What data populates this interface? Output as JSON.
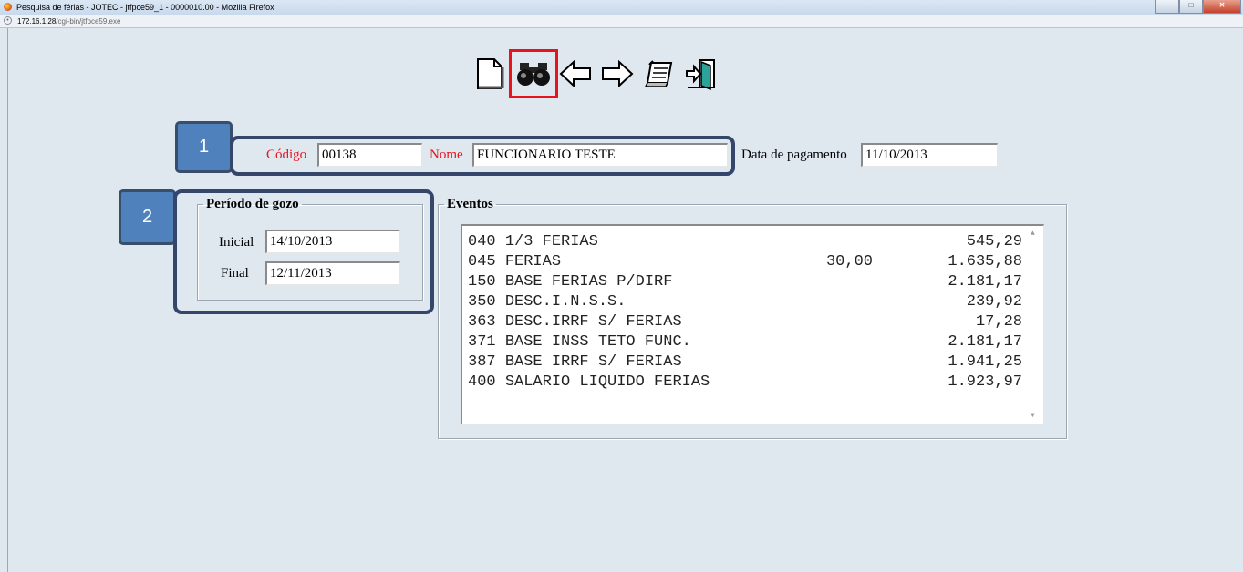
{
  "window": {
    "title": "Pesquisa de férias - JOTEC - jtfpce59_1 - 0000010.00 - Mozilla Firefox"
  },
  "address": {
    "host": "172.16.1.28",
    "path": "/cgi-bin/jtfpce59.exe"
  },
  "toolbar": {
    "icons": [
      "new-document-icon",
      "binoculars-search-icon",
      "arrow-left-icon",
      "arrow-right-icon",
      "notepad-icon",
      "exit-door-icon"
    ],
    "selected": "binoculars-search-icon",
    "highlight_color": "#e8141c"
  },
  "annotations": {
    "box1": "1",
    "box2": "2",
    "color": "#4f81bd"
  },
  "header": {
    "codigo_label": "Código",
    "codigo_value": "00138",
    "nome_label": "Nome",
    "nome_value": "FUNCIONARIO TESTE",
    "data_label": "Data de pagamento",
    "data_value": "11/10/2013"
  },
  "periodo": {
    "legend": "Período de gozo",
    "inicial_label": "Inicial",
    "inicial_value": "14/10/2013",
    "final_label": "Final",
    "final_value": "12/11/2013"
  },
  "eventos": {
    "legend": "Eventos",
    "rows": [
      {
        "code": "040",
        "desc": "1/3 FERIAS",
        "ref": "",
        "value": "545,29"
      },
      {
        "code": "045",
        "desc": "FERIAS",
        "ref": "30,00",
        "value": "1.635,88"
      },
      {
        "code": "150",
        "desc": "BASE FERIAS P/DIRF",
        "ref": "",
        "value": "2.181,17"
      },
      {
        "code": "350",
        "desc": "DESC.I.N.S.S.",
        "ref": "",
        "value": "239,92"
      },
      {
        "code": "363",
        "desc": "DESC.IRRF S/ FERIAS",
        "ref": "",
        "value": "17,28"
      },
      {
        "code": "371",
        "desc": "BASE INSS TETO FUNC.",
        "ref": "",
        "value": "2.181,17"
      },
      {
        "code": "387",
        "desc": "BASE IRRF S/ FERIAS",
        "ref": "",
        "value": "1.941,25"
      },
      {
        "code": "400",
        "desc": "SALARIO LIQUIDO FERIAS",
        "ref": "",
        "value": "1.923,97"
      }
    ]
  }
}
